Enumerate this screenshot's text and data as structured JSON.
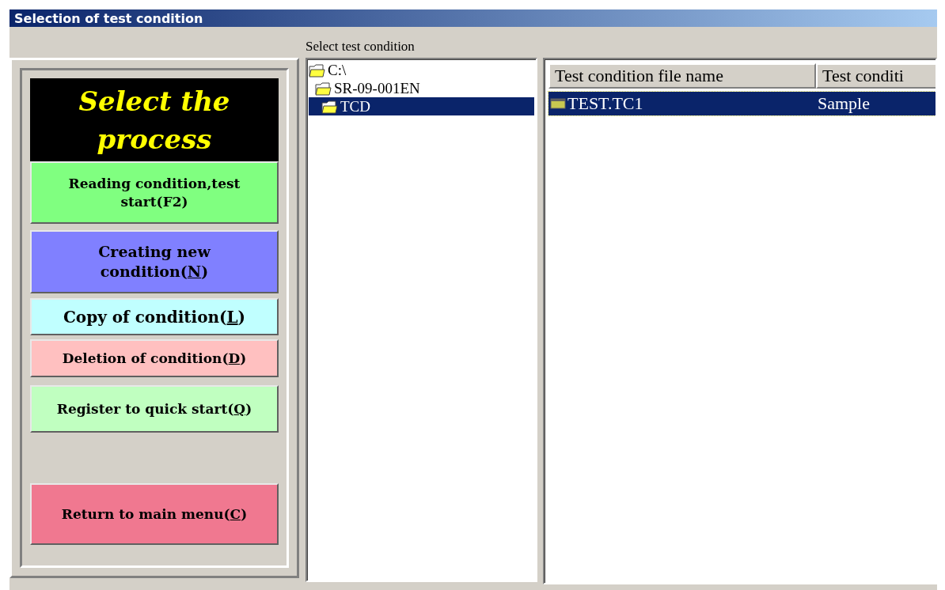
{
  "window": {
    "title": "Selection of test condition"
  },
  "process_panel": {
    "heading": "Select the process",
    "buttons": [
      {
        "label_start": "Reading condition,test start(F2)",
        "color": "#80ff80"
      },
      {
        "label_start": "Creating new condition(",
        "mnemonic": "N",
        "label_end": ")",
        "color": "#8080ff"
      },
      {
        "label_start": "Copy of condition(",
        "mnemonic": "L",
        "label_end": ")",
        "color": "#c0ffff"
      },
      {
        "label_start": "Deletion of condition(",
        "mnemonic": "D",
        "label_end": ")",
        "color": "#ffc0c0"
      },
      {
        "label_start": "Register to quick start(",
        "mnemonic": "Q",
        "label_end": ")",
        "color": "#c0ffc0"
      },
      {
        "label_start": "Return to main menu(",
        "mnemonic": "C",
        "label_end": ")",
        "color": "#f07890"
      }
    ]
  },
  "tree": {
    "label": "Select test condition",
    "items": [
      {
        "label": "C:\\",
        "selected": false,
        "children": [
          {
            "label": "SR-09-001EN",
            "selected": false,
            "children": [
              {
                "label": "TCD",
                "selected": true
              }
            ]
          }
        ]
      }
    ]
  },
  "file_list": {
    "columns": [
      "Test condition file name",
      "Test conditi"
    ],
    "rows": [
      {
        "cells": [
          "TEST.TC1",
          "Sample"
        ],
        "selected": true
      }
    ]
  }
}
